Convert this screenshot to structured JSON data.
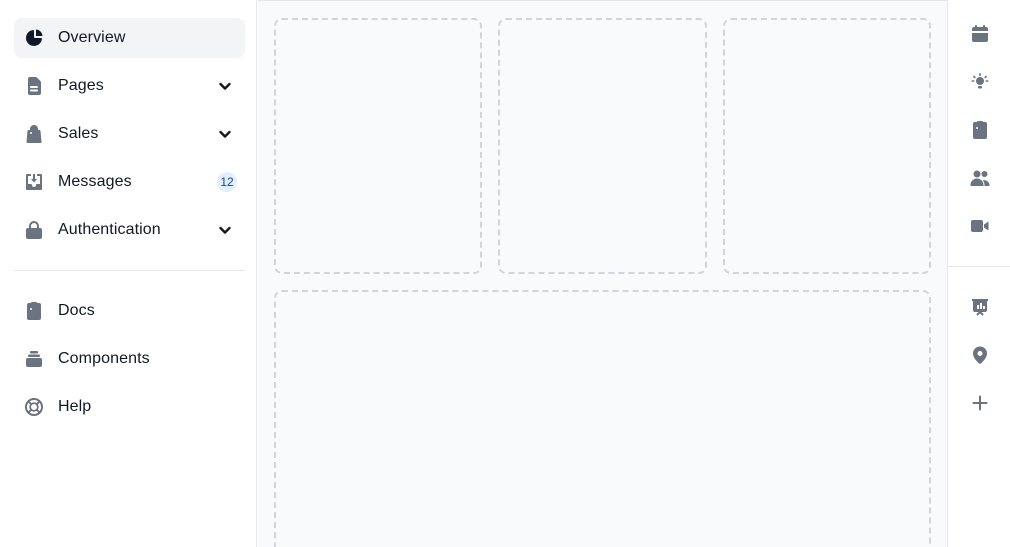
{
  "sidebar": {
    "items": [
      {
        "label": "Overview",
        "icon": "chart-pie-icon",
        "active": true
      },
      {
        "label": "Pages",
        "icon": "document-icon",
        "has_submenu": true
      },
      {
        "label": "Sales",
        "icon": "shopping-bag-icon",
        "has_submenu": true
      },
      {
        "label": "Messages",
        "icon": "inbox-icon",
        "badge": "12"
      },
      {
        "label": "Authentication",
        "icon": "lock-icon",
        "has_submenu": true
      }
    ],
    "secondary_items": [
      {
        "label": "Docs",
        "icon": "clipboard-list-icon"
      },
      {
        "label": "Components",
        "icon": "collection-icon"
      },
      {
        "label": "Help",
        "icon": "support-icon"
      }
    ]
  },
  "rail": {
    "icons": [
      "calendar-icon",
      "lightbulb-icon",
      "clipboard-icon",
      "users-icon",
      "video-camera-icon",
      "presentation-chart-icon",
      "location-pin-icon",
      "plus-icon"
    ]
  },
  "colors": {
    "active_bg": "#f3f4f6",
    "icon_gray": "#6b7280",
    "badge_bg": "#e1effe",
    "badge_text": "#1e429f",
    "main_bg": "#f9fafb",
    "dashed_border": "#d1d5db"
  }
}
